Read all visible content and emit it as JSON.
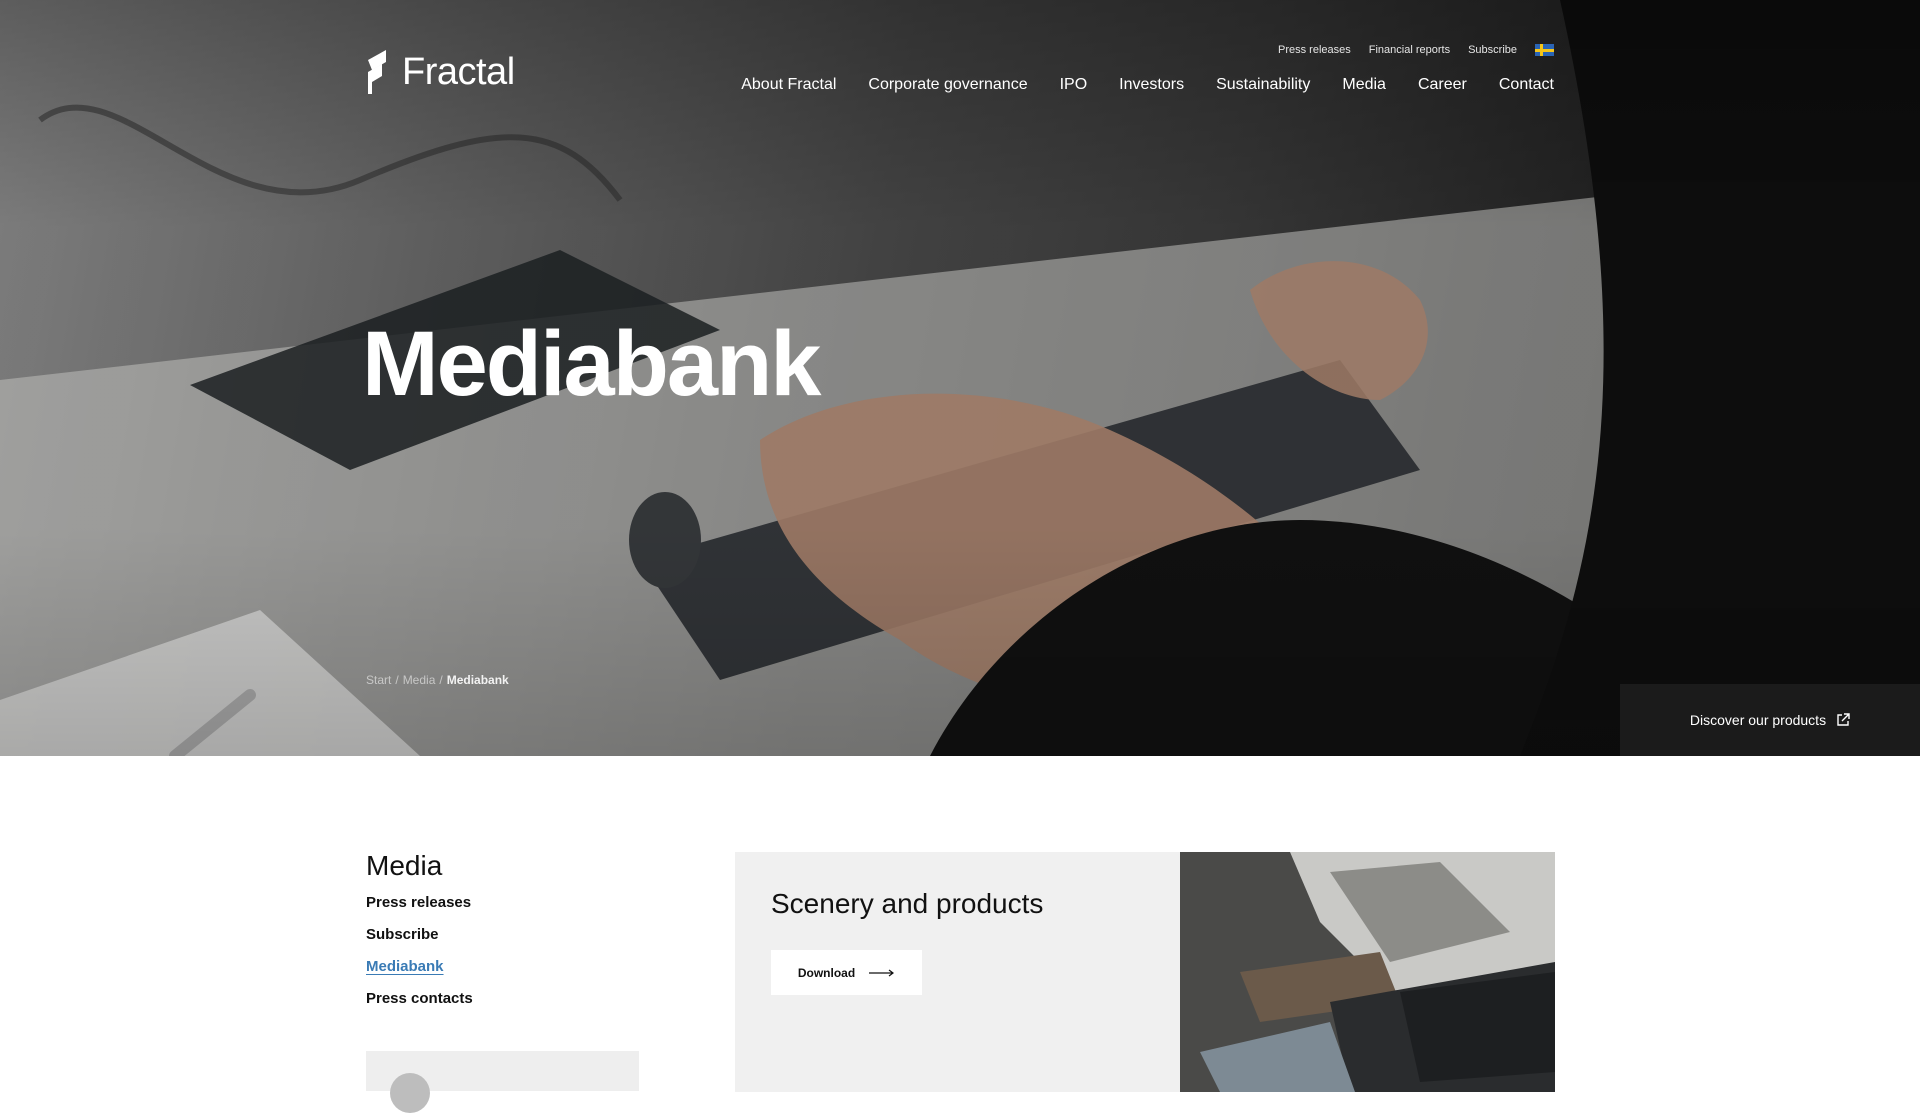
{
  "brand": {
    "name": "Fractal"
  },
  "top_links": [
    "Press releases",
    "Financial reports",
    "Subscribe"
  ],
  "language": {
    "flag": "swedish-flag-icon"
  },
  "main_nav": [
    "About Fractal",
    "Corporate governance",
    "IPO",
    "Investors",
    "Sustainability",
    "Media",
    "Career",
    "Contact"
  ],
  "hero": {
    "title": "Mediabank",
    "breadcrumb": [
      "Start",
      "Media",
      "Mediabank"
    ],
    "breadcrumb_separator": "/",
    "cta": "Discover our products",
    "cta_icon": "external-link-icon"
  },
  "sidebar": {
    "title": "Media",
    "items": [
      {
        "label": "Press releases",
        "active": false
      },
      {
        "label": "Subscribe",
        "active": false
      },
      {
        "label": "Mediabank",
        "active": true
      },
      {
        "label": "Press contacts",
        "active": false
      }
    ]
  },
  "card": {
    "title": "Scenery and products",
    "button": "Download",
    "button_icon": "arrow-right-icon"
  },
  "colors": {
    "accent_link": "#3a7bb5",
    "card_bg": "#f0f0f0",
    "cta_bg": "#1b1b1b"
  }
}
